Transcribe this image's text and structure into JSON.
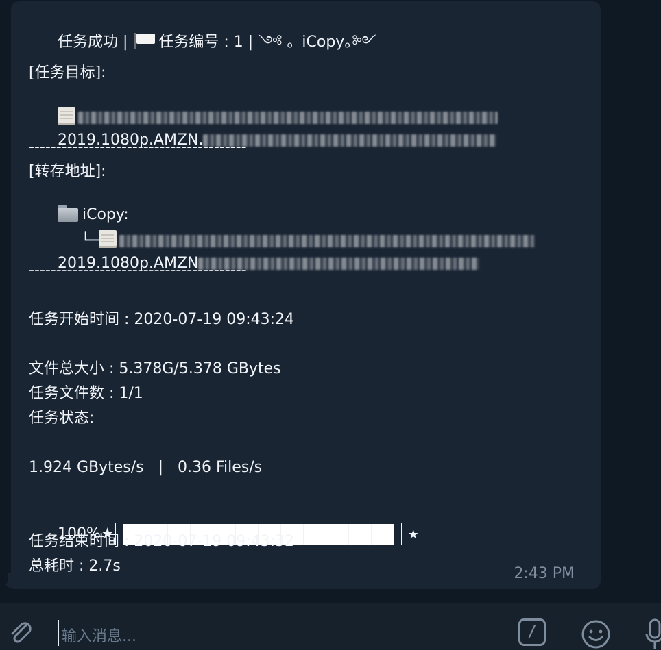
{
  "message": {
    "header": {
      "status": "任务成功",
      "sep1": " | ",
      "task_id_label": "任务编号 : 1",
      "sep2": " | ",
      "brand": "༺ 。iCopy。༻"
    },
    "target_label": "[任务目标]:",
    "target_line2_visible": "2019.1080p.AMZN.",
    "divider": "----------------------------------------",
    "dest_label": "[转存地址]:",
    "dest_folder": "iCopy:",
    "tree_prefix": "└─",
    "dest_line2_visible": "2019.1080p.AMZN",
    "divider2": "----------------------------------------",
    "start_time": "任务开始时间 : 2020-07-19 09:43:24",
    "total_size": "文件总大小 : 5.378G/5.378 GBytes",
    "file_count": "任务文件数 : 1/1",
    "status_label": "任务状态:",
    "speed": "1.924 GBytes/s   |   0.36 Files/s",
    "progress_text": "100%★",
    "progress_end": "★",
    "progress_fraction": 1.0,
    "end_time": "任务结束时间 : 2020-07-19 09:43:32",
    "elapsed": "总耗时 : 2.7s",
    "timestamp": "2:43 PM"
  },
  "composer": {
    "placeholder": "输入消息...",
    "command_icon_label": "/"
  },
  "colors": {
    "chat_background": "#0f1923",
    "bubble_background": "#1a2534",
    "text": "#f1f5f9",
    "timestamp": "#7f8fa1",
    "composer_background": "#17212b"
  },
  "icons": {
    "attach": "paperclip-icon",
    "command": "slash-command-icon",
    "emoji": "smile-icon",
    "mic": "microphone-icon"
  }
}
